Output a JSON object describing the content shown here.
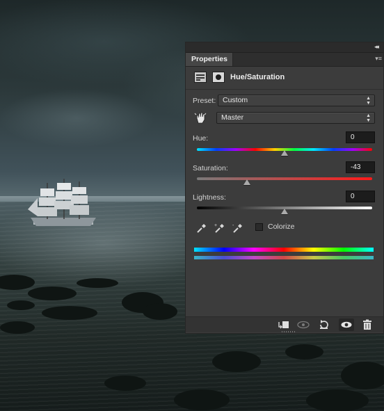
{
  "panel": {
    "tab_label": "Properties",
    "title": "Hue/Saturation",
    "preset_label": "Preset:",
    "preset_value": "Custom",
    "channel_value": "Master",
    "hue_label": "Hue:",
    "hue_value": "0",
    "saturation_label": "Saturation:",
    "saturation_value": "-43",
    "lightness_label": "Lightness:",
    "lightness_value": "0",
    "colorize_label": "Colorize",
    "colorize_checked": false
  },
  "sliders": {
    "hue": {
      "value": 0,
      "min": -180,
      "max": 180
    },
    "saturation": {
      "value": -43,
      "min": -100,
      "max": 100
    },
    "lightness": {
      "value": 0,
      "min": -100,
      "max": 100
    }
  },
  "icons": {
    "collapse": "double-chevron-right-icon",
    "menu": "panel-menu-icon",
    "adjustment": "hue-saturation-adjustment-icon",
    "mask": "layer-mask-icon",
    "targeted_adjustment": "hand-scrubby-icon",
    "eyedroppers": [
      "eyedropper-icon",
      "eyedropper-add-icon",
      "eyedropper-subtract-icon"
    ],
    "footer": [
      "clip-to-layer-icon",
      "view-previous-state-icon",
      "reset-icon",
      "visibility-eye-icon",
      "delete-trash-icon"
    ]
  }
}
